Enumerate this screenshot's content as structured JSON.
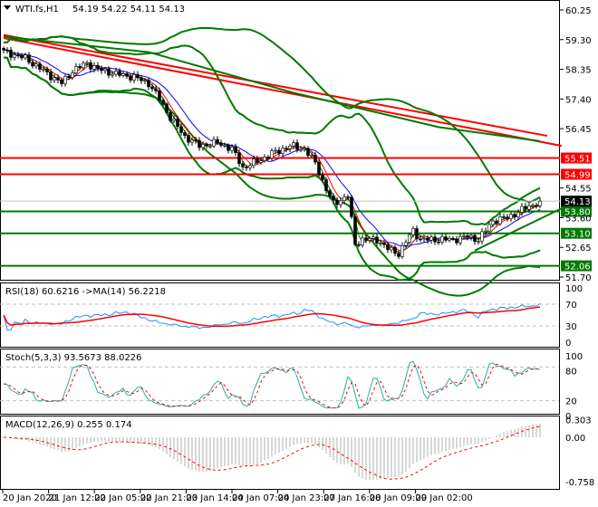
{
  "header": {
    "symbol": "WTI.fs,H1",
    "ohlc": "54.19 54.22 54.11 54.13"
  },
  "colors": {
    "bull": "#ffffff",
    "bear": "#000000",
    "bands": "#007a00",
    "ma_red": "#ff0000",
    "ma_blue": "#0000ff",
    "level_red": "#ff0000",
    "level_green": "#007a00",
    "rsi": "#1e90ff",
    "stoch_main": "#20b2aa"
  },
  "chart_data": [
    {
      "type": "candlestick",
      "title": "WTI.fs,H1",
      "ylim": [
        51.7,
        60.25
      ],
      "y_ticks": [
        "60.25",
        "59.30",
        "58.35",
        "57.40",
        "56.45",
        "54.55",
        "53.60",
        "52.65",
        "51.70"
      ],
      "x_ticks": [
        "20 Jan 2020",
        "21 Jan 12:00",
        "22 Jan 05:00",
        "22 Jan 21:00",
        "23 Jan 14:00",
        "24 Jan 07:00",
        "24 Jan 23:00",
        "27 Jan 16:00",
        "28 Jan 09:00",
        "29 Jan 02:00"
      ],
      "close_keypoints": [
        [
          0,
          58.92
        ],
        [
          6,
          58.7
        ],
        [
          11,
          58.3
        ],
        [
          16,
          57.9
        ],
        [
          19,
          58.3
        ],
        [
          23,
          58.55
        ],
        [
          26,
          58.35
        ],
        [
          31,
          58.2
        ],
        [
          36,
          58.1
        ],
        [
          40,
          57.9
        ],
        [
          43,
          57.4
        ],
        [
          46,
          56.8
        ],
        [
          50,
          56.2
        ],
        [
          54,
          55.9
        ],
        [
          59,
          56.0
        ],
        [
          63,
          55.8
        ],
        [
          66,
          55.2
        ],
        [
          70,
          55.4
        ],
        [
          74,
          55.65
        ],
        [
          79,
          55.9
        ],
        [
          83,
          55.8
        ],
        [
          86,
          55.35
        ],
        [
          89,
          54.5
        ],
        [
          91,
          54.05
        ],
        [
          95,
          54.3
        ],
        [
          97,
          52.75
        ],
        [
          99,
          52.9
        ],
        [
          103,
          52.9
        ],
        [
          106,
          52.6
        ],
        [
          109,
          52.45
        ],
        [
          113,
          53.2
        ],
        [
          115,
          52.9
        ],
        [
          119,
          52.9
        ],
        [
          124,
          52.9
        ],
        [
          128,
          53.0
        ],
        [
          131,
          52.9
        ],
        [
          135,
          53.5
        ],
        [
          139,
          53.6
        ],
        [
          143,
          53.85
        ],
        [
          148,
          54.13
        ]
      ],
      "levels": [
        {
          "price": 55.51,
          "label": "55.51",
          "color": "red"
        },
        {
          "price": 54.99,
          "label": "54.99",
          "color": "red"
        },
        {
          "price": 53.8,
          "label": "53.80",
          "color": "green"
        },
        {
          "price": 53.1,
          "label": "53.10",
          "color": "green"
        },
        {
          "price": 52.06,
          "label": "52.06",
          "color": "green"
        }
      ],
      "current_price": {
        "price": 54.13,
        "label": "54.13"
      },
      "long_lines": [
        {
          "color": "red",
          "points": [
            [
              0,
              59.45
            ],
            [
              150,
              56.22
            ]
          ]
        },
        {
          "color": "red",
          "points": [
            [
              0,
              59.35
            ],
            [
              154,
              55.9
            ]
          ]
        },
        {
          "color": "green",
          "points": [
            [
              0,
              59.4
            ],
            [
              40,
              58.9
            ],
            [
              80,
              57.6
            ],
            [
              120,
              56.5
            ],
            [
              148,
              56.05
            ]
          ]
        },
        {
          "color": "green",
          "points": [
            [
              130,
              52.55
            ],
            [
              154,
              53.9
            ]
          ]
        }
      ]
    },
    {
      "type": "line",
      "title": "RSI(18) 60.6216 ->MA(14) 56.2218",
      "ylim": [
        0,
        100
      ],
      "levels": [
        30,
        70
      ],
      "y_ticks": [
        "100",
        "70",
        "30",
        "0"
      ]
    },
    {
      "type": "line",
      "title": "Stoch(5,3,3) 93.5673 88.0226",
      "ylim": [
        0,
        100
      ],
      "levels": [
        20,
        80
      ],
      "y_ticks": [
        "100",
        "80",
        "20",
        "0"
      ]
    },
    {
      "type": "bar",
      "title": "MACD(12,26,9) 0.255 0.174",
      "ylim": [
        -0.758,
        0.303
      ],
      "y_ticks": [
        "0.303",
        "0.00",
        "-0.758"
      ]
    }
  ]
}
